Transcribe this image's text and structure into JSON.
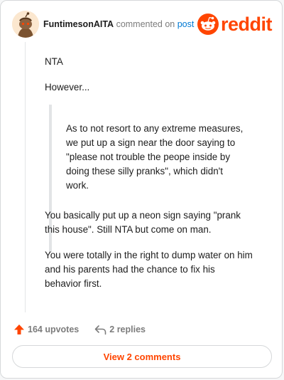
{
  "header": {
    "author": "FuntimesonAITA",
    "action_text": "commented on",
    "post_link": "post",
    "brand_word": "reddit"
  },
  "comment": {
    "paragraph_1": "NTA",
    "paragraph_2": "However...",
    "quote_line_1": "As to not resort to any extreme measures,",
    "quote_line_2": "we put up a sign near the door saying to",
    "quote_line_3": "\"please not trouble the peope inside by",
    "quote_line_4": "doing these silly pranks\", which didn't",
    "quote_line_5": "work.",
    "paragraph_3_line_1": "You basically put up a neon sign saying \"prank",
    "paragraph_3_line_2": "this house\". Still NTA but come on man.",
    "paragraph_4_line_1": "You were totally in the right to dump water on him",
    "paragraph_4_line_2": "and his parents had the chance to fix his",
    "paragraph_4_line_3": "behavior first."
  },
  "actions": {
    "upvotes": "164 upvotes",
    "replies": "2 replies"
  },
  "footer": {
    "view_comments_label": "View 2 comments"
  },
  "colors": {
    "brand": "#ff4500",
    "link": "#0079d3",
    "muted": "#7c7c7c"
  },
  "icons": [
    "snoo-avatar-icon",
    "reddit-logo-icon",
    "upvote-arrow-icon",
    "reply-arrow-icon"
  ]
}
